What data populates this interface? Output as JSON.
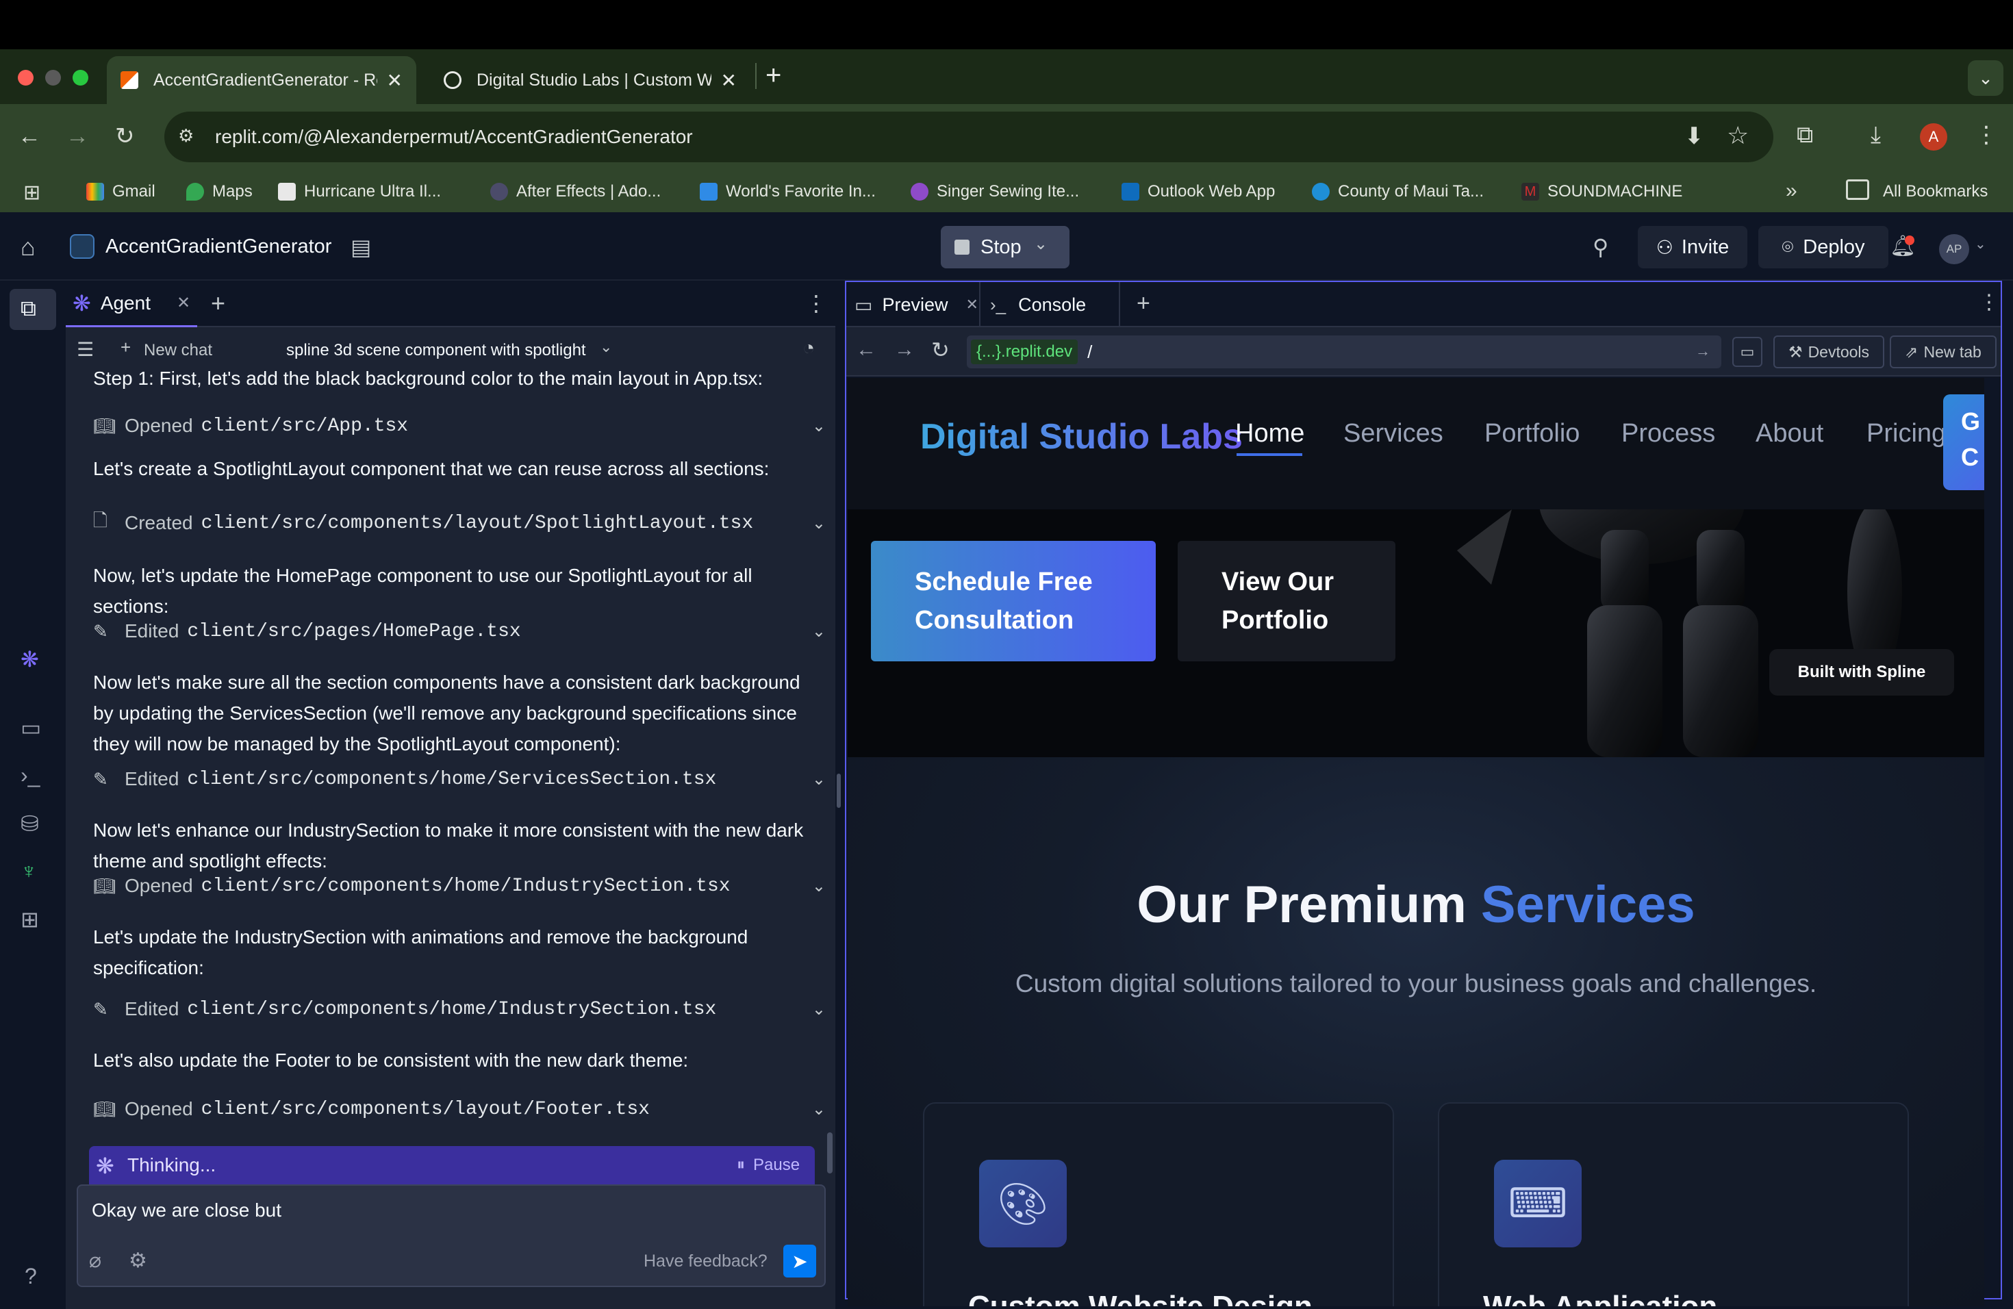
{
  "browser": {
    "tabs": [
      {
        "title": "AccentGradientGenerator - Re",
        "active": true
      },
      {
        "title": "Digital Studio Labs | Custom W",
        "active": false
      }
    ],
    "url": "replit.com/@Alexanderpermut/AccentGradientGenerator",
    "profile_initial": "A",
    "bookmarks": [
      "Gmail",
      "Maps",
      "Hurricane Ultra Il...",
      "After Effects | Ado...",
      "World's Favorite In...",
      "Singer Sewing Ite...",
      "Outlook Web App",
      "County of Maui Ta...",
      "SOUNDMACHINE"
    ],
    "all_bookmarks": "All Bookmarks"
  },
  "app": {
    "project_name": "AccentGradientGenerator",
    "stop_label": "Stop",
    "invite_label": "Invite",
    "deploy_label": "Deploy",
    "avatar_initials": "AP"
  },
  "agent": {
    "tab_label": "Agent",
    "new_chat": "New chat",
    "chat_title": "spline 3d scene component with spotlight",
    "items": [
      {
        "type": "msg",
        "text": "Step 1: First, let's add the black background color to the main layout in App.tsx:"
      },
      {
        "type": "file",
        "action": "Opened",
        "path": "client/src/App.tsx"
      },
      {
        "type": "msg",
        "text": "Let's create a SpotlightLayout component that we can reuse across all sections:"
      },
      {
        "type": "file",
        "action": "Created",
        "path": "client/src/components/layout/SpotlightLayout.tsx"
      },
      {
        "type": "msg",
        "text": "Now, let's update the HomePage component to use our SpotlightLayout for all sections:"
      },
      {
        "type": "file",
        "action": "Edited",
        "path": "client/src/pages/HomePage.tsx"
      },
      {
        "type": "msg",
        "text": "Now let's make sure all the section components have a consistent dark background by updating the ServicesSection (we'll remove any background specifications since they will now be managed by the SpotlightLayout component):"
      },
      {
        "type": "file",
        "action": "Edited",
        "path": "client/src/components/home/ServicesSection.tsx"
      },
      {
        "type": "msg",
        "text": "Now let's enhance our IndustrySection to make it more consistent with the new dark theme and spotlight effects:"
      },
      {
        "type": "file",
        "action": "Opened",
        "path": "client/src/components/home/IndustrySection.tsx"
      },
      {
        "type": "msg",
        "text": "Let's update the IndustrySection with animations and remove the background specification:"
      },
      {
        "type": "file",
        "action": "Edited",
        "path": "client/src/components/home/IndustrySection.tsx"
      },
      {
        "type": "msg",
        "text": "Let's also update the Footer to be consistent with the new dark theme:"
      },
      {
        "type": "file",
        "action": "Opened",
        "path": "client/src/components/layout/Footer.tsx"
      }
    ],
    "thinking_label": "Thinking...",
    "pause_label": "Pause",
    "input_value": "Okay we are close but",
    "feedback_label": "Have feedback?"
  },
  "preview": {
    "tab_preview": "Preview",
    "tab_console": "Console",
    "domain": "{...}.replit.dev",
    "path": "/",
    "devtools_label": "Devtools",
    "newtab_label": "New tab"
  },
  "site": {
    "logo": "Digital Studio Labs",
    "nav": [
      "Home",
      "Services",
      "Portfolio",
      "Process",
      "About",
      "Pricing"
    ],
    "cta_edge": "G",
    "cta_edge2": "C",
    "btn_primary_line1": "Schedule Free",
    "btn_primary_line2": "Consultation",
    "btn_secondary_line1": "View Our",
    "btn_secondary_line2": "Portfolio",
    "spline_badge": "Built with Spline",
    "services_title_a": "Our Premium",
    "services_title_b": "Services",
    "services_subtitle": "Custom digital solutions tailored to your business goals and challenges.",
    "cards": [
      {
        "title": "Custom Website Design",
        "icon": "palette-icon"
      },
      {
        "title": "Web Application",
        "icon": "code-laptop-icon"
      }
    ]
  }
}
